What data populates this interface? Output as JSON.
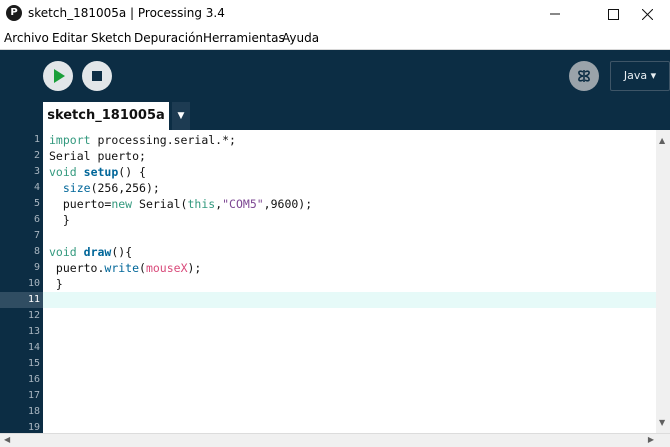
{
  "window": {
    "title": "sketch_181005a | Processing 3.4",
    "logo_glyph": "P"
  },
  "menu": [
    "Archivo",
    "Editar",
    "Sketch",
    "Depuración",
    "Herramientas",
    "Ayuda"
  ],
  "toolbar": {
    "mode_label": "Java ▾"
  },
  "tabs": [
    {
      "label": "sketch_181005a",
      "active": true
    }
  ],
  "editor": {
    "line_numbers": [
      "1",
      "2",
      "3",
      "4",
      "5",
      "6",
      "7",
      "8",
      "9",
      "10",
      "11",
      "12",
      "13",
      "14",
      "15",
      "16",
      "17",
      "18",
      "19"
    ],
    "current_line": 11,
    "code": [
      {
        "tokens": [
          {
            "t": "import",
            "c": "kw"
          },
          {
            "t": " processing.serial.*;",
            "c": ""
          }
        ]
      },
      {
        "tokens": [
          {
            "t": "Serial puerto;",
            "c": ""
          }
        ]
      },
      {
        "tokens": [
          {
            "t": "void",
            "c": "kw"
          },
          {
            "t": " ",
            "c": ""
          },
          {
            "t": "setup",
            "c": "fnb"
          },
          {
            "t": "() {",
            "c": ""
          }
        ]
      },
      {
        "tokens": [
          {
            "t": "  ",
            "c": ""
          },
          {
            "t": "size",
            "c": "fn"
          },
          {
            "t": "(256,256);",
            "c": ""
          }
        ]
      },
      {
        "tokens": [
          {
            "t": "  puerto=",
            "c": ""
          },
          {
            "t": "new",
            "c": "kw"
          },
          {
            "t": " Serial(",
            "c": ""
          },
          {
            "t": "this",
            "c": "kw"
          },
          {
            "t": ",",
            "c": ""
          },
          {
            "t": "\"COM5\"",
            "c": "str"
          },
          {
            "t": ",9600);",
            "c": ""
          }
        ]
      },
      {
        "tokens": [
          {
            "t": "  }",
            "c": ""
          }
        ]
      },
      {
        "tokens": [
          {
            "t": "",
            "c": ""
          }
        ]
      },
      {
        "tokens": [
          {
            "t": "void",
            "c": "kw"
          },
          {
            "t": " ",
            "c": ""
          },
          {
            "t": "draw",
            "c": "fnb"
          },
          {
            "t": "(){",
            "c": ""
          }
        ]
      },
      {
        "tokens": [
          {
            "t": " puerto.",
            "c": ""
          },
          {
            "t": "write",
            "c": "fn"
          },
          {
            "t": "(",
            "c": ""
          },
          {
            "t": "mouseX",
            "c": "var"
          },
          {
            "t": ");",
            "c": ""
          }
        ]
      },
      {
        "tokens": [
          {
            "t": " }",
            "c": ""
          }
        ]
      },
      {
        "tokens": [
          {
            "t": "",
            "c": ""
          }
        ]
      }
    ]
  },
  "colors": {
    "toolbar_bg": "#0c2d44",
    "run_green": "#1a9f3a",
    "current_line": "#e6faf8"
  }
}
